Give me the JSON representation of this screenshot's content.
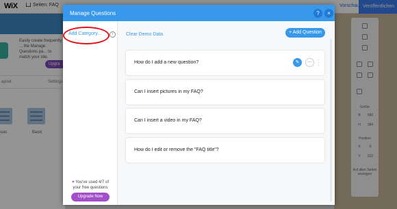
{
  "editor": {
    "logo": "WiX",
    "page_label": "Seiten: FAQ",
    "preview": "Vorschau",
    "publish": "Veröffentlichen",
    "bg_description": "Easily create frequently ... the Manage Questions pa... to match your site.",
    "bg_upgrade": "Upgra",
    "bg_tab_layout": "ayout",
    "bg_tab_settings": "Settings",
    "bg_thumb_label_1": "ssic",
    "bg_thumb_label_2": "Basic",
    "right_panel": {
      "size": "Größe",
      "w": "B",
      "w_value": "580",
      "h": "H",
      "h_value": "384",
      "position": "Position",
      "x": "X",
      "x_value": "0",
      "y": "Y",
      "y_value": "222",
      "all_pages": "Auf allen Seiten anzeigen"
    }
  },
  "modal": {
    "title": "Manage Questions",
    "help_label": "?",
    "close_label": "×",
    "add_category": "Add Category...",
    "info_label": "i",
    "clear_demo": "Clear Demo Data",
    "add_question": "+ Add Question",
    "questions": [
      "How do I add a new question?",
      "Can I insert pictures in my FAQ?",
      "Can I insert a video in my FAQ?",
      "How do I edit or remove the \"FAQ title\"?"
    ],
    "edit_label": "✎",
    "more_label": "...",
    "drag_label": "⋮",
    "usage_heart": "♥",
    "usage_text": "You've used 4/7 of your free questions",
    "upgrade_now": "Upgrade Now"
  },
  "colors": {
    "accent": "#3899ec",
    "upgrade_purple": "#a24fc9",
    "annotation_red": "#e0161b"
  }
}
